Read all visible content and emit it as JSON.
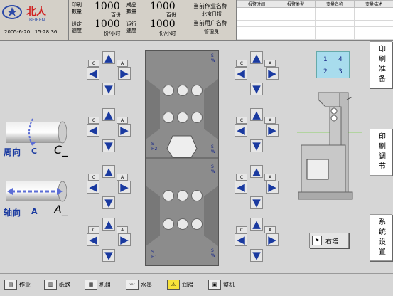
{
  "header": {
    "brand": "北人",
    "brand_sub": "BEIREN",
    "date": "2005-6-20",
    "time": "15:28:36",
    "print_qty_label": "印刷\n数量",
    "print_qty": "1000",
    "print_qty_unit": "百份",
    "finished_label": "成品\n数量",
    "finished": "1000",
    "finished_unit": "百份",
    "set_speed_label": "设定\n速度",
    "set_speed": "1000",
    "set_speed_unit": "份/小时",
    "run_speed_label": "运行\n速度",
    "run_speed": "1000",
    "run_speed_unit": "份/小时",
    "job_name_label": "当前作业名称",
    "job_name": "北京日报",
    "user_name_label": "当前用户名称",
    "user_name": "管理员"
  },
  "alarm": {
    "columns": [
      "报警时间",
      "报警类型",
      "变量名称",
      "变量描述"
    ]
  },
  "pads": {
    "left_label": "C",
    "right_label": "A"
  },
  "legend": {
    "circ_label": "周向",
    "circ_letter": "C",
    "circ_var": "C_",
    "axial_label": "轴向",
    "axial_letter": "A",
    "axial_var": "A_"
  },
  "machine": {
    "sw": "S\nW",
    "h2": "S\nH2",
    "h1": "S\nH1"
  },
  "tower": {
    "numbers": [
      "1",
      "4",
      "2",
      "3"
    ],
    "right_tower_label": "右塔"
  },
  "side": {
    "btn1": "印刷准备",
    "btn2": "印刷调节",
    "btn3": "系统设置"
  },
  "toolbar": {
    "job": "作业",
    "paper": "纸路",
    "unit": "机组",
    "ink": "水墨",
    "lube": "润滑",
    "complete": "整机"
  },
  "colors": {
    "arrow": "#1a3aa0",
    "tower_box": "#a8dced",
    "accent_line": "#8fd16a"
  }
}
